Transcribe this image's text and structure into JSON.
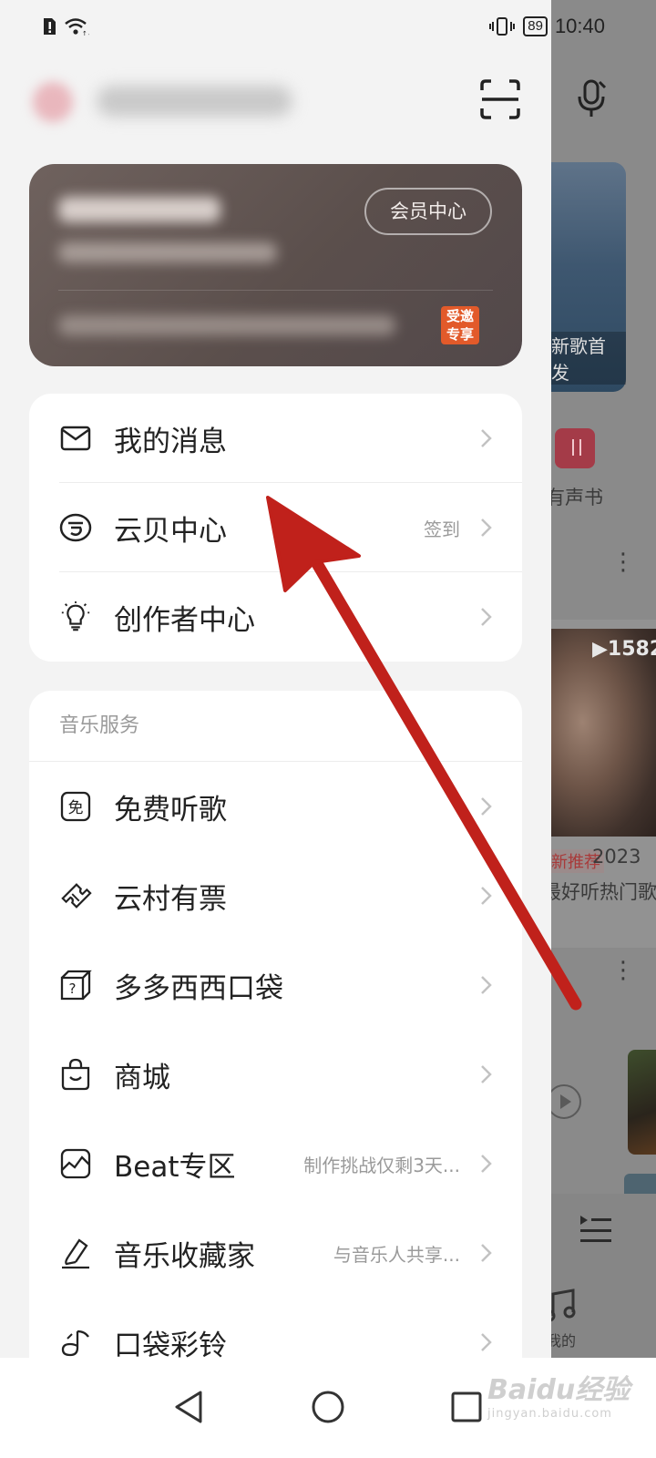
{
  "status_bar": {
    "battery": "89",
    "time": "10:40"
  },
  "vip_card": {
    "center_button": "会员中心",
    "badge_line1": "受邀",
    "badge_line2": "专享"
  },
  "account_menu": [
    {
      "label": "我的消息",
      "icon": "mail-icon",
      "extra": ""
    },
    {
      "label": "云贝中心",
      "icon": "cloud-coin-icon",
      "extra": "签到"
    },
    {
      "label": "创作者中心",
      "icon": "lightbulb-icon",
      "extra": ""
    }
  ],
  "music_services": {
    "header": "音乐服务",
    "items": [
      {
        "label": "免费听歌",
        "icon": "free-icon",
        "extra": ""
      },
      {
        "label": "云村有票",
        "icon": "ticket-icon",
        "extra": ""
      },
      {
        "label": "多多西西口袋",
        "icon": "pocket-box-icon",
        "extra": ""
      },
      {
        "label": "商城",
        "icon": "shopping-bag-icon",
        "extra": ""
      },
      {
        "label": "Beat专区",
        "icon": "beat-icon",
        "extra": "制作挑战仅剩3天..."
      },
      {
        "label": "音乐收藏家",
        "icon": "collector-icon",
        "extra": "与音乐人共享..."
      },
      {
        "label": "口袋彩铃",
        "icon": "ringtone-icon",
        "extra": ""
      }
    ]
  },
  "background_app": {
    "image_caption": "新歌首发",
    "audiobook_label": "有声书",
    "play_count": "▶1582",
    "recommend_tag": "新推荐",
    "year_text": "2023",
    "song_title": "最好听热门歌",
    "nav_label": "我的"
  },
  "watermark": {
    "brand": "Baidu经验",
    "url": "jingyan.baidu.com"
  },
  "colors": {
    "arrow": "#c0211b",
    "vip_card": "#5f5350",
    "badge": "#e25a2a"
  }
}
